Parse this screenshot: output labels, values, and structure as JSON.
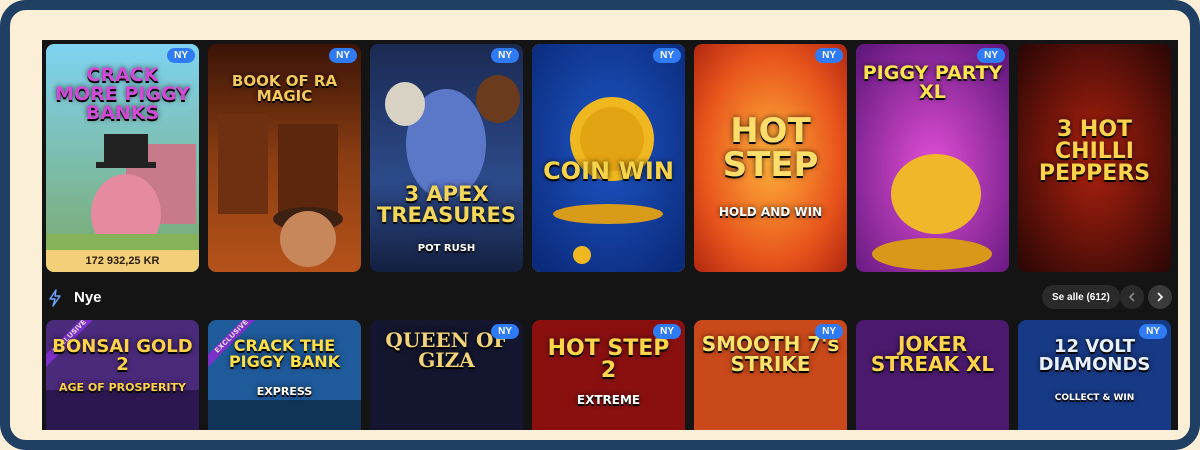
{
  "new_badge": "NY",
  "top_row": [
    {
      "title": "CRACK MORE PIGGY BANKS",
      "badge": "NY",
      "jackpot": "172 932,25 KR"
    },
    {
      "title": "BOOK OF RA MAGIC",
      "badge": "NY"
    },
    {
      "title": "3 APEX TREASURES",
      "subtitle": "POT RUSH",
      "badge": "NY"
    },
    {
      "title": "COIN WIN",
      "badge": "NY"
    },
    {
      "title": "HOT STEP",
      "subtitle": "HOLD AND WIN",
      "badge": "NY"
    },
    {
      "title": "PIGGY PARTY XL",
      "badge": "NY"
    },
    {
      "title": "3 HOT CHILLI PEPPERS"
    }
  ],
  "section": {
    "title": "Nye",
    "see_all": "Se alle (612)"
  },
  "bottom_row": [
    {
      "title": "BONSAI GOLD 2",
      "subtitle": "AGE OF PROSPERITY",
      "ribbon": "EXCLUSIVE"
    },
    {
      "title": "CRACK THE PIGGY BANK",
      "subtitle": "EXPRESS",
      "ribbon": "EXCLUSIVE"
    },
    {
      "title": "QUEEN OF GIZA",
      "badge": "NY"
    },
    {
      "title": "HOT STEP 2",
      "subtitle": "EXTREME",
      "badge": "NY"
    },
    {
      "title": "SMOOTH 7's STRIKE",
      "badge": "NY"
    },
    {
      "title": "JOKER STREAK XL"
    },
    {
      "title": "12 VOLT DIAMONDS",
      "subtitle": "COLLECT & WIN",
      "badge": "NY"
    }
  ],
  "colors": {
    "frame": "#1f3f63",
    "outer_background": "#fbefd7",
    "screen_background": "#141414",
    "badge": "#2f7bf5",
    "jackpot_bar": "#f3cf7a",
    "selected_outline": "#f1c232"
  },
  "icons": {
    "section": "lightning-bolt-icon",
    "prev": "chevron-left-icon",
    "next": "chevron-right-icon"
  }
}
